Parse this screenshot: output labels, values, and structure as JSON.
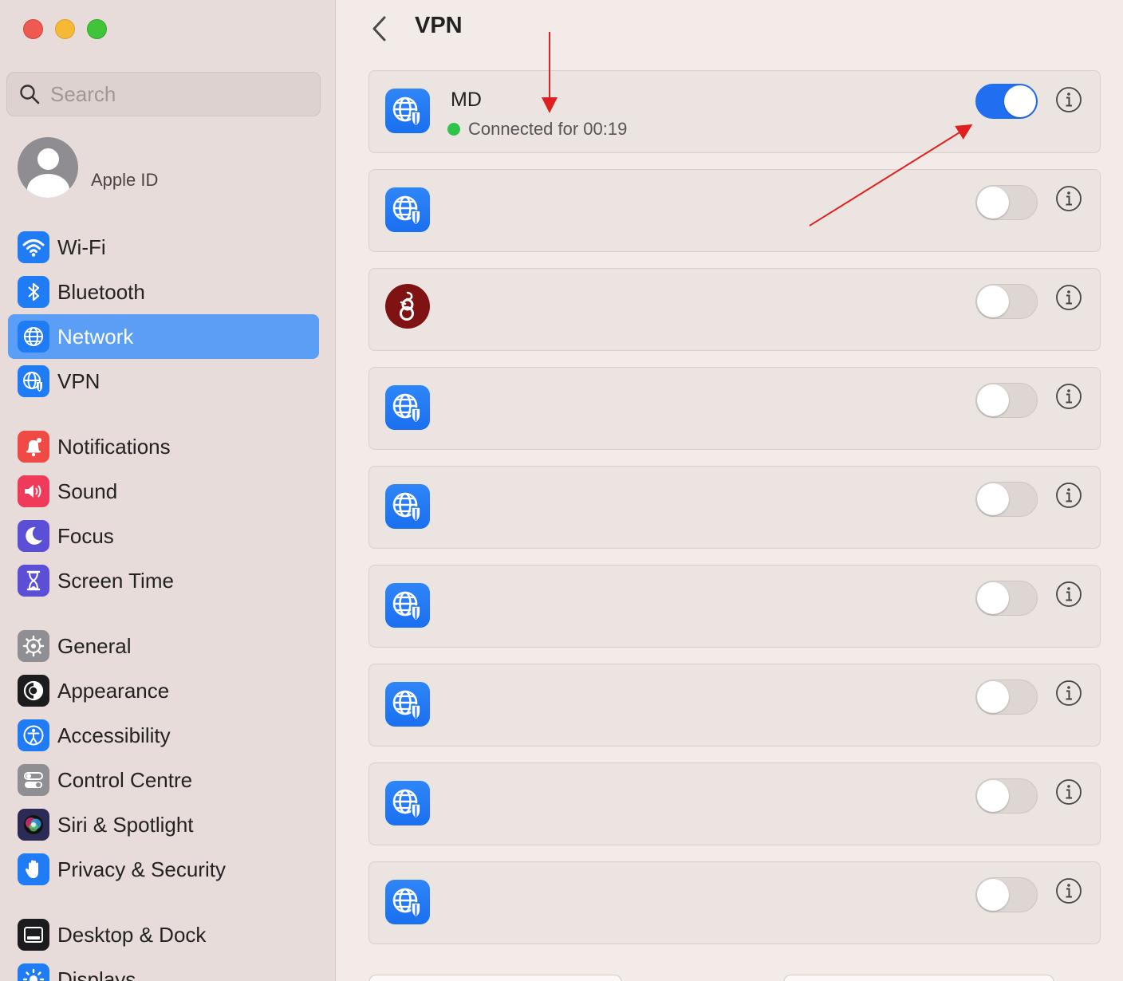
{
  "window": {
    "traffic_lights": [
      "close",
      "minimize",
      "maximize"
    ]
  },
  "sidebar": {
    "search": {
      "placeholder": "Search",
      "value": ""
    },
    "apple_id": {
      "label": "Apple ID"
    },
    "groups": [
      [
        {
          "label": "Wi-Fi",
          "icon": "wifi-icon",
          "color": "#1f7cf5"
        },
        {
          "label": "Bluetooth",
          "icon": "bluetooth-icon",
          "color": "#1f7cf5"
        },
        {
          "label": "Network",
          "icon": "globe-icon",
          "color": "#1f7cf5",
          "active": true
        },
        {
          "label": "VPN",
          "icon": "vpn-globe-icon",
          "color": "#1f7cf5"
        }
      ],
      [
        {
          "label": "Notifications",
          "icon": "bell-icon",
          "color": "#f04a45"
        },
        {
          "label": "Sound",
          "icon": "speaker-icon",
          "color": "#f03a5a"
        },
        {
          "label": "Focus",
          "icon": "moon-icon",
          "color": "#5b4fd6"
        },
        {
          "label": "Screen Time",
          "icon": "hourglass-icon",
          "color": "#5b4fd6"
        }
      ],
      [
        {
          "label": "General",
          "icon": "gear-icon",
          "color": "#8e8e93"
        },
        {
          "label": "Appearance",
          "icon": "appearance-icon",
          "color": "#1c1c1e"
        },
        {
          "label": "Accessibility",
          "icon": "accessibility-icon",
          "color": "#1f7cf5"
        },
        {
          "label": "Control Centre",
          "icon": "control-centre-icon",
          "color": "#8e8e93"
        },
        {
          "label": "Siri & Spotlight",
          "icon": "siri-icon",
          "color": "#2b2b55"
        },
        {
          "label": "Privacy & Security",
          "icon": "hand-icon",
          "color": "#1f7cf5"
        }
      ],
      [
        {
          "label": "Desktop & Dock",
          "icon": "dock-icon",
          "color": "#1c1c1e"
        },
        {
          "label": "Displays",
          "icon": "sun-icon",
          "color": "#1f7cf5"
        }
      ]
    ]
  },
  "main": {
    "title": "VPN",
    "connections": [
      {
        "name": "MD",
        "status": "Connected for 00:19",
        "on": true,
        "icon": "vpn-globe-icon"
      },
      {
        "name": "",
        "status": "",
        "on": false,
        "icon": "vpn-globe-icon"
      },
      {
        "name": "",
        "status": "",
        "on": false,
        "icon": "wireguard-icon"
      },
      {
        "name": "",
        "status": "",
        "on": false,
        "icon": "vpn-globe-icon"
      },
      {
        "name": "",
        "status": "",
        "on": false,
        "icon": "vpn-globe-icon"
      },
      {
        "name": "",
        "status": "",
        "on": false,
        "icon": "vpn-globe-icon"
      },
      {
        "name": "",
        "status": "",
        "on": false,
        "icon": "vpn-globe-icon"
      },
      {
        "name": "",
        "status": "",
        "on": false,
        "icon": "vpn-globe-icon"
      },
      {
        "name": "",
        "status": "",
        "on": false,
        "icon": "vpn-globe-icon"
      }
    ]
  },
  "colors": {
    "accent": "#1f6ff0",
    "sidebar_active": "#5b9ef5",
    "status_connected": "#2ec44a",
    "annotation": "#e02020"
  }
}
